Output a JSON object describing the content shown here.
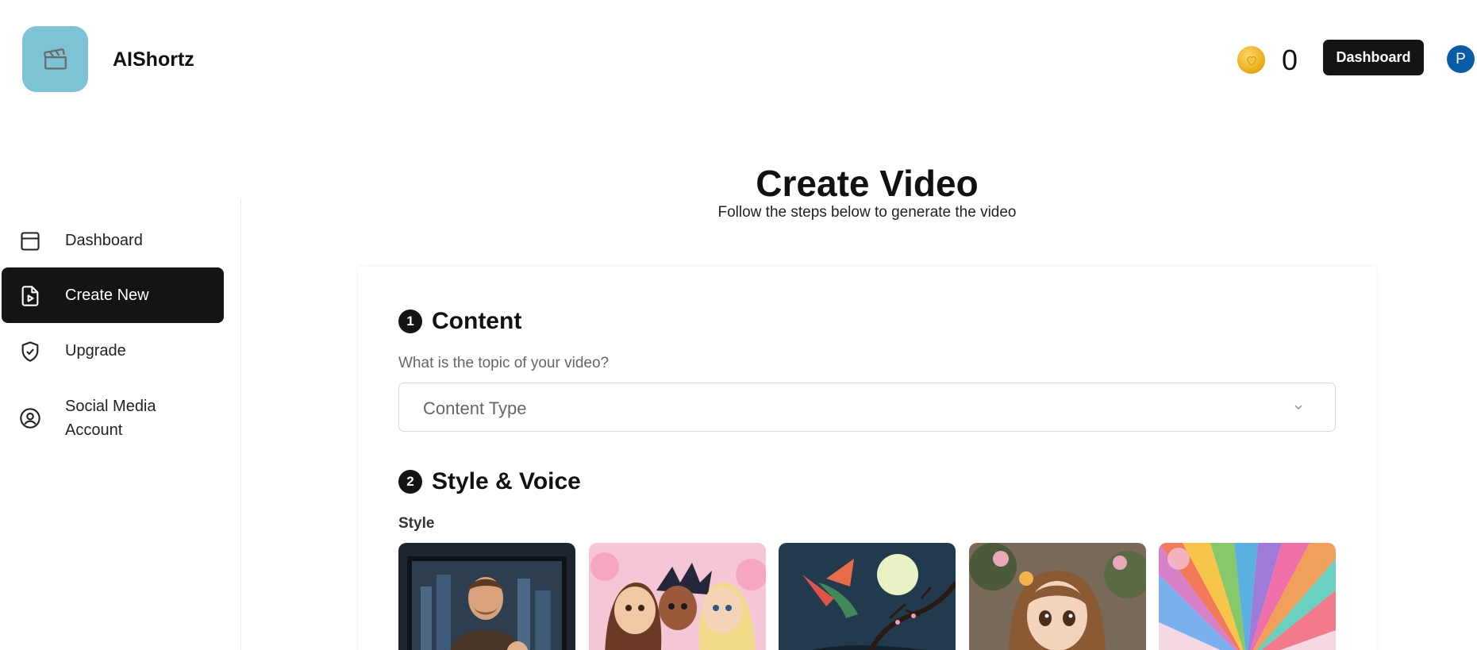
{
  "header": {
    "app_title": "AIShortz",
    "coin_count": "0",
    "dashboard_button": "Dashboard",
    "avatar_initial": "P",
    "logo_icon": "clapperboard-icon",
    "coin_icon": "coin-heart-icon"
  },
  "sidebar": {
    "items": [
      {
        "label": "Dashboard",
        "icon": "layout-panel-icon",
        "active": false
      },
      {
        "label": "Create New",
        "icon": "file-video-icon",
        "active": true
      },
      {
        "label": "Upgrade",
        "icon": "shield-check-icon",
        "active": false
      },
      {
        "label": "Social Media Account",
        "label_line1": "Social Media",
        "label_line2": "Account",
        "icon": "user-circle-icon",
        "active": false
      }
    ]
  },
  "main": {
    "title": "Create Video",
    "subtitle": "Follow the steps below to generate the video",
    "steps": [
      {
        "number": "1",
        "title": "Content"
      },
      {
        "number": "2",
        "title": "Style & Voice"
      }
    ],
    "content": {
      "question": "What is the topic of your video?",
      "select_placeholder": "Content Type"
    },
    "style": {
      "label": "Style",
      "thumbnails": [
        "realistic-style-image",
        "cartoon-style-image",
        "fantasy-style-image",
        "anime-style-image",
        "abstract-style-image"
      ]
    }
  },
  "colors": {
    "accent": "#141414",
    "logo_bg": "#7cc3d6",
    "avatar_bg": "#0b5ca8",
    "coin": "#e7a812"
  }
}
